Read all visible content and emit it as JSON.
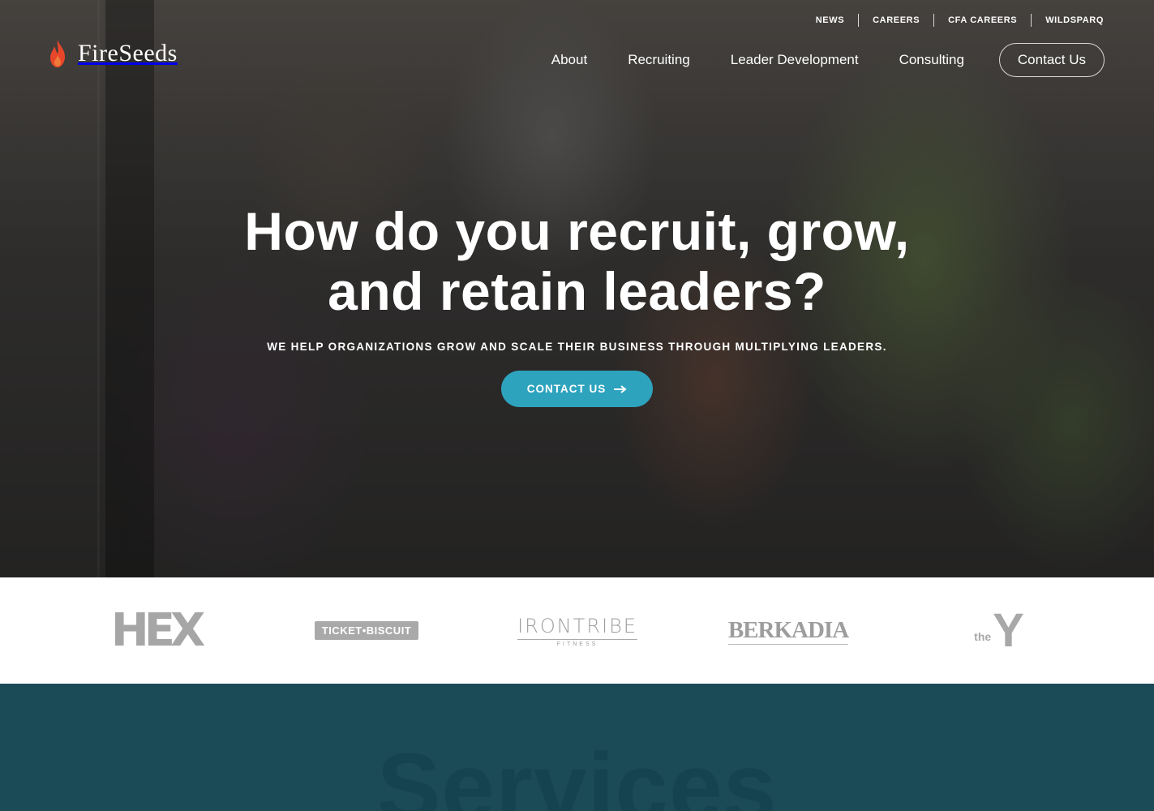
{
  "brand": {
    "name": "FireSeeds",
    "icon": "flame-icon",
    "icon_color": "#e8462a"
  },
  "utility_nav": [
    "NEWS",
    "CAREERS",
    "CFA CAREERS",
    "WILDSPARQ"
  ],
  "main_nav": {
    "items": [
      "About",
      "Recruiting",
      "Leader Development",
      "Consulting"
    ],
    "contact_label": "Contact Us"
  },
  "hero": {
    "headline_line1": "How do you recruit, grow,",
    "headline_line2": "and retain leaders?",
    "subhead": "WE HELP ORGANIZATIONS GROW AND SCALE THEIR BUSINESS THROUGH MULTIPLYING LEADERS.",
    "cta_label": "CONTACT US",
    "cta_icon": "arrow-right-icon",
    "cta_color": "#2ea3bd"
  },
  "clients": {
    "hex": "HEX",
    "ticket_biscuit": "TICKET•BISCUIT",
    "irontribe": "IRONTRIBE",
    "irontribe_sub": "FITNESS",
    "berkadia": "BERKADIA",
    "ymca_the": "the",
    "ymca_y": "Y"
  },
  "services": {
    "title": "Services",
    "background": "#1a4b57"
  }
}
